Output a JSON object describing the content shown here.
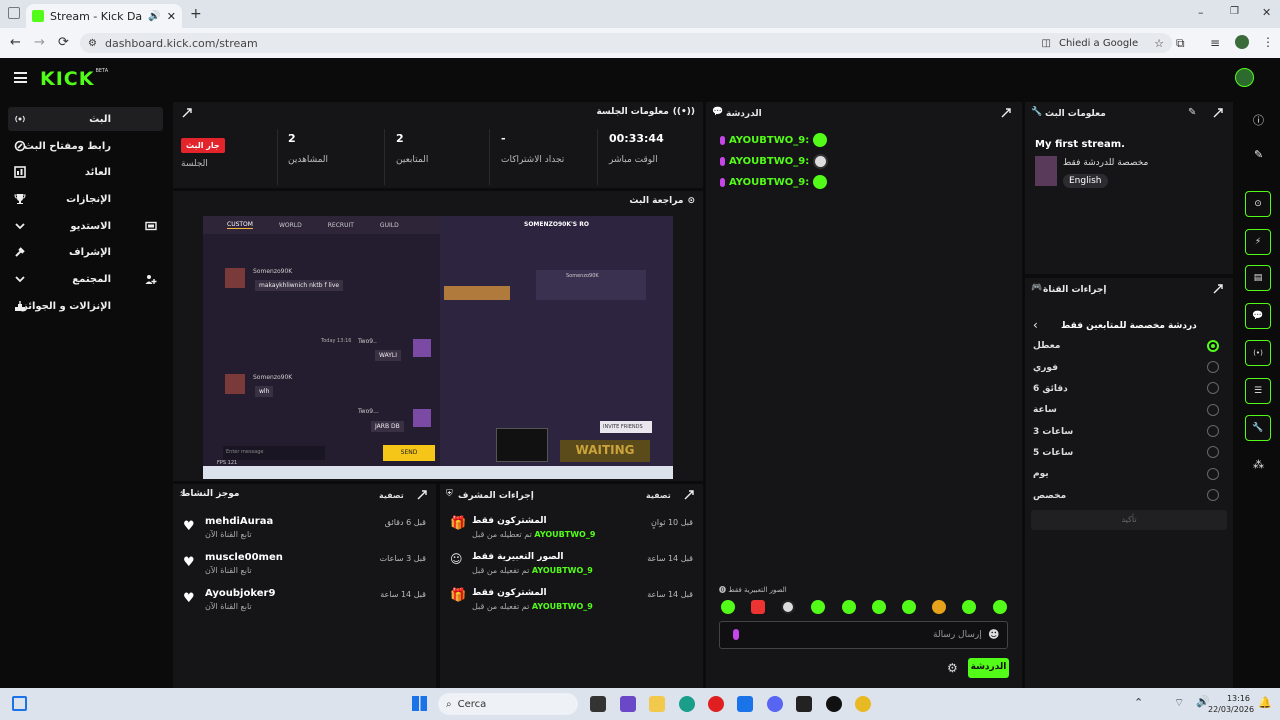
{
  "browser": {
    "tab_title": "Stream - Kick Dashboard",
    "url": "dashboard.kick.com/stream",
    "ask_google": "Chiedi a Google"
  },
  "brand": {
    "logo": "KICK",
    "beta": "BETA",
    "accent": "#53fc18"
  },
  "sidebar": {
    "items": [
      {
        "label": "البث",
        "icon": "broadcast-icon"
      },
      {
        "label": "رابط ومفتاح البث",
        "icon": "link-icon"
      },
      {
        "label": "العائد",
        "icon": "revenue-icon"
      },
      {
        "label": "الإنجازات",
        "icon": "trophy-icon"
      },
      {
        "label": "الاستديو",
        "icon": "studio-icon"
      },
      {
        "label": "الإشراف",
        "icon": "moderation-icon"
      },
      {
        "label": "المجتمع",
        "icon": "community-icon"
      },
      {
        "label": "الإنزالات و الجوائز",
        "icon": "drops-icon"
      }
    ]
  },
  "session": {
    "title": "معلومات الجلسة",
    "status_badge": "جار البث",
    "status_label": "الجلسة",
    "viewers_value": "2",
    "viewers_label": "المشاهدين",
    "followers_value": "2",
    "followers_label": "المتابعين",
    "subs_value": "-",
    "subs_label": "تجداد الاشتراكات",
    "time_value": "00:33:44",
    "time_label": "الوقت مباشر"
  },
  "preview": {
    "title": "مراجعة البث",
    "game": {
      "tabs": [
        "CUSTOM",
        "WORLD",
        "RECRUIT",
        "GUILD"
      ],
      "room_title": "SOMENZO90K'S RO",
      "player_name": "Somenzo90K",
      "chat_user": "Somenzo90K",
      "chat_msg1": "makaykhliwnich nktb f live",
      "time1": "Today 13:16",
      "reply_user": "Two9..",
      "reply1": "WAYLI",
      "chat_msg2": "wlh",
      "reply2": "JARB DB",
      "input_placeholder": "Enter message",
      "send": "SEND",
      "invite": "INVITE FRIENDS",
      "waiting": "WAITING",
      "fps": "FPS 121",
      "two9": "Two9..."
    }
  },
  "activity": {
    "title": "موجز النشاط",
    "filter": "تصفية",
    "items": [
      {
        "name": "mehdiAuraa",
        "time": "قبل 6 دقائق",
        "sub": "تابع القناة الآن"
      },
      {
        "name": "muscle00men",
        "time": "قبل 3 ساعات",
        "sub": "تابع القناة الآن"
      },
      {
        "name": "Ayoubjoker9",
        "time": "قبل 14 ساعة",
        "sub": "تابع القناة الآن"
      }
    ]
  },
  "modactions": {
    "title": "إجراءات المشرف",
    "filter": "تصفية",
    "items": [
      {
        "title": "المشتركون فقط",
        "time": "قبل 10 ثوانٍ",
        "user": "AYOUBTWO_9",
        "sub": "تم تعطيله من قبل"
      },
      {
        "title": "الصور التعبيرية فقط",
        "time": "قبل 14 ساعة",
        "user": "AYOUBTWO_9",
        "sub": "تم تفعيله من قبل"
      },
      {
        "title": "المشتركون فقط",
        "time": "قبل 14 ساعة",
        "user": "AYOUBTWO_9",
        "sub": "تم تفعيله من قبل"
      }
    ]
  },
  "chat": {
    "title": "الدردشة",
    "messages": [
      {
        "user": "AYOUBTWO_9:"
      },
      {
        "user": "AYOUBTWO_9:"
      },
      {
        "user": "AYOUBTWO_9:"
      }
    ],
    "emote_only_label": "الصور التعبيرية فقط",
    "input_placeholder": "إرسال رسالة",
    "send_label": "الدردشة"
  },
  "streaminfo": {
    "title": "معلومات البث",
    "stream_title": "My first stream.",
    "category": "مخصصة للدردشة فقط",
    "language": "English"
  },
  "channel_actions": {
    "title": "إجراءات القناة",
    "sub_title": "دردشة مخصصة للمتابعين فقط",
    "options": [
      {
        "label": "معطل",
        "selected": true
      },
      {
        "label": "فوري",
        "selected": false
      },
      {
        "label": "6 دقائق",
        "selected": false
      },
      {
        "label": "ساعة",
        "selected": false
      },
      {
        "label": "3 ساعات",
        "selected": false
      },
      {
        "label": "5 ساعات",
        "selected": false
      },
      {
        "label": "يوم",
        "selected": false
      },
      {
        "label": "مخصص",
        "selected": false
      }
    ],
    "confirm": "تأكيد"
  },
  "taskbar": {
    "search": "Cerca",
    "time": "13:16",
    "date": "22/03/2026"
  }
}
